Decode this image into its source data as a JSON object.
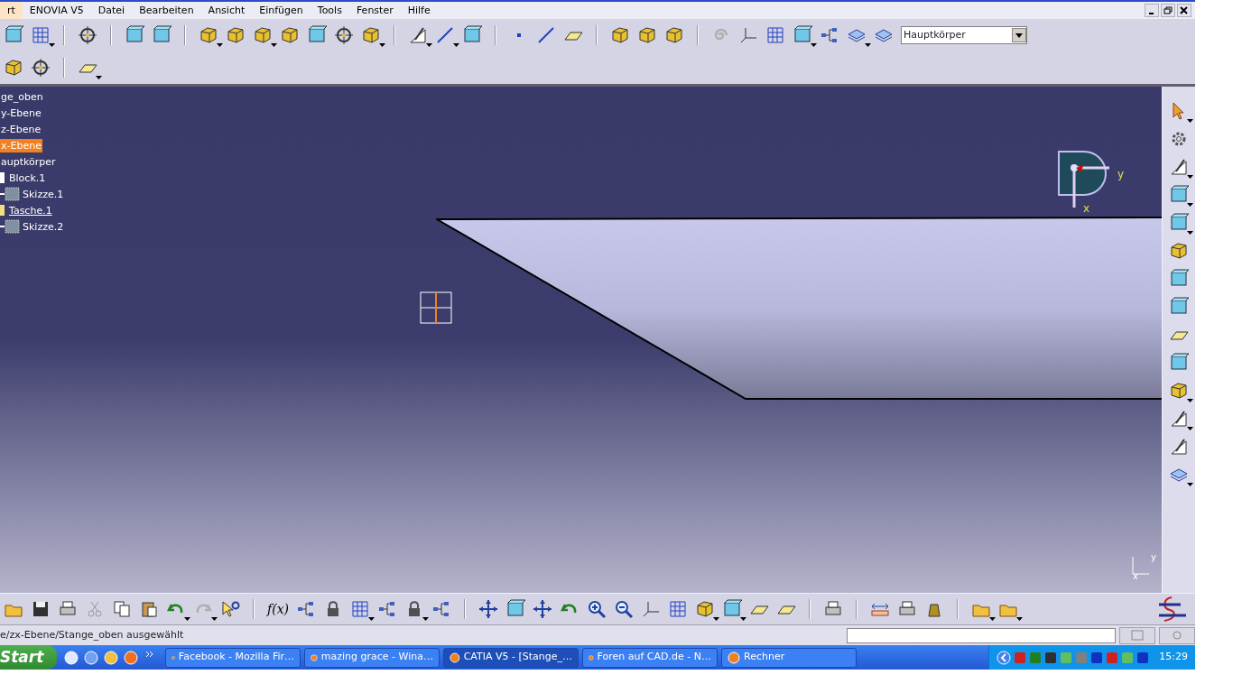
{
  "menu_bar": [
    {
      "label": "rt",
      "selected": true
    },
    {
      "label": "ENOVIA V5",
      "selected": false
    },
    {
      "label": "Datei",
      "selected": false
    },
    {
      "label": "Bearbeiten",
      "selected": false
    },
    {
      "label": "Ansicht",
      "selected": false
    },
    {
      "label": "Einfügen",
      "selected": false
    },
    {
      "label": "Tools",
      "selected": false
    },
    {
      "label": "Fenster",
      "selected": false
    },
    {
      "label": "Hilfe",
      "selected": false
    }
  ],
  "toolbar": {
    "body_selector": "Hauptkörper",
    "formula_button": "f(x)"
  },
  "tree": [
    {
      "label": "ge_oben",
      "selected": false,
      "current": false,
      "children": [
        {
          "label": "y-Ebene",
          "selected": false,
          "current": false
        },
        {
          "label": "z-Ebene",
          "selected": false,
          "current": false
        },
        {
          "label": "x-Ebene",
          "selected": true,
          "current": false
        },
        {
          "label": "auptkörper",
          "selected": false,
          "current": false,
          "children": [
            {
              "label": "Block.1",
              "kind": "feature",
              "selected": false,
              "current": false,
              "children": [
                {
                  "label": "Skizze.1",
                  "kind": "sketch",
                  "selected": false,
                  "current": false
                }
              ]
            },
            {
              "label": "Tasche.1",
              "kind": "feature",
              "selected": false,
              "current": true,
              "children": [
                {
                  "label": "Skizze.2",
                  "kind": "sketch",
                  "selected": false,
                  "current": false
                }
              ]
            }
          ]
        }
      ]
    }
  ],
  "viewport": {
    "compass_labels": [
      "y",
      "x"
    ],
    "triad_labels": [
      "y",
      "x"
    ]
  },
  "status_bar": {
    "message": "e/zx-Ebene/Stange_oben ausgewählt"
  },
  "taskbar": {
    "start": "Start",
    "tasks": [
      {
        "label": "Facebook - Mozilla Fir…",
        "selected": false
      },
      {
        "label": "mazing grace - Wina…",
        "selected": false
      },
      {
        "label": "CATIA V5 - [Stange_…",
        "selected": true
      },
      {
        "label": "Foren auf CAD.de - N…",
        "selected": false
      },
      {
        "label": "Rechner",
        "selected": false
      }
    ],
    "clock": "15:29"
  }
}
